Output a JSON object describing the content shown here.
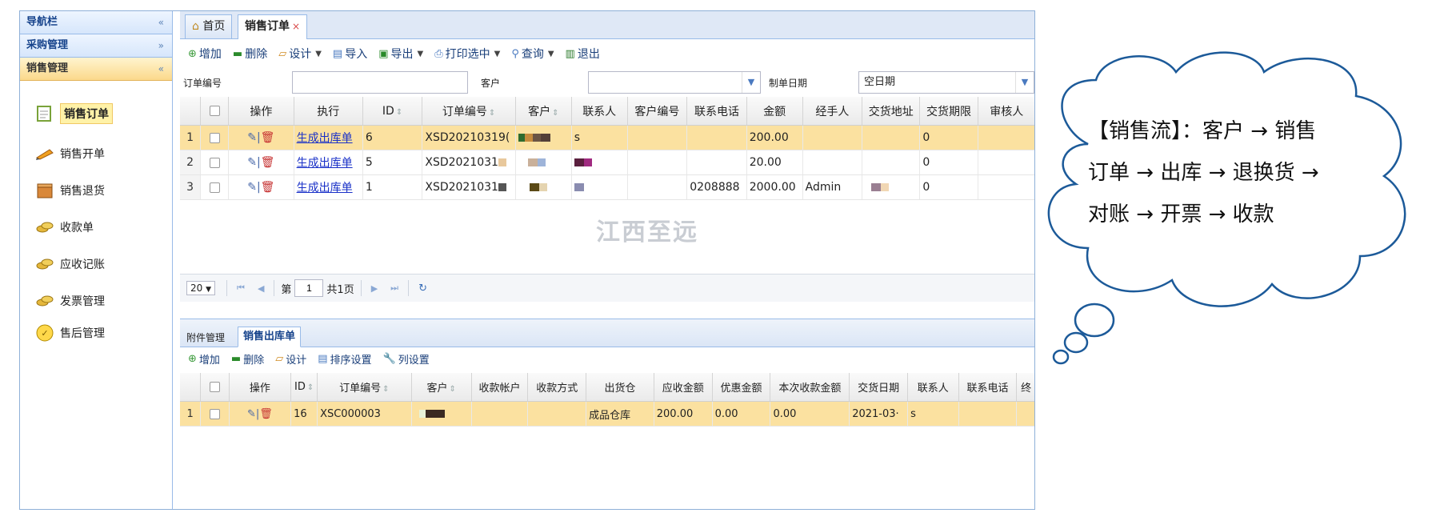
{
  "sidebar": {
    "title": "导航栏",
    "title_chev": "«",
    "groups": [
      {
        "label": "采购管理",
        "chev": "»"
      },
      {
        "label": "销售管理",
        "chev": "«"
      }
    ],
    "items": [
      {
        "label": "销售订单",
        "icon": "document-icon"
      },
      {
        "label": "销售开单",
        "icon": "pencil-icon"
      },
      {
        "label": "销售退货",
        "icon": "box-icon"
      },
      {
        "label": "收款单",
        "icon": "coins-icon"
      },
      {
        "label": "应收记账",
        "icon": "coins-icon"
      },
      {
        "label": "发票管理",
        "icon": "coins-icon"
      },
      {
        "label": "售后管理",
        "icon": "thumbs-up-icon"
      }
    ]
  },
  "tabs": [
    {
      "label": "首页"
    },
    {
      "label": "销售订单",
      "close": "×"
    }
  ],
  "toolbar": {
    "add": "增加",
    "delete": "删除",
    "design": "设计",
    "import": "导入",
    "export": "导出",
    "print": "打印选中",
    "query": "查询",
    "exit": "退出"
  },
  "filters": {
    "order_no_label": "订单编号",
    "order_no_value": "",
    "customer_label": "客户",
    "customer_value": "",
    "date_label": "制单日期",
    "date_value": "空日期"
  },
  "grid": {
    "columns": [
      "操作",
      "执行",
      "ID",
      "订单编号",
      "客户",
      "联系人",
      "客户编号",
      "联系电话",
      "金额",
      "经手人",
      "交货地址",
      "交货期限",
      "审核人"
    ],
    "rows": [
      {
        "num": "1",
        "exec": "生成出库单",
        "id": "6",
        "order": "XSD20210319(",
        "contact": "s",
        "cust_no": "",
        "phone": "",
        "amount": "200.00",
        "handler": "",
        "address": "",
        "deadline": "0",
        "auditor": ""
      },
      {
        "num": "2",
        "exec": "生成出库单",
        "id": "5",
        "order": "XSD2021031",
        "contact": "",
        "cust_no": "",
        "phone": "",
        "amount": "20.00",
        "handler": "",
        "address": "",
        "deadline": "0",
        "auditor": ""
      },
      {
        "num": "3",
        "exec": "生成出库单",
        "id": "1",
        "order": "XSD2021031",
        "contact": "",
        "cust_no": "",
        "phone": "0208888",
        "amount": "2000.00",
        "handler": "Admin",
        "address": "",
        "deadline": "0",
        "auditor": ""
      }
    ]
  },
  "pager": {
    "page_size": "20",
    "page_prefix": "第",
    "page": "1",
    "page_suffix": "共1页"
  },
  "watermark": "江西至远",
  "lower_tabs": [
    {
      "label": "附件管理"
    },
    {
      "label": "销售出库单"
    }
  ],
  "lower_toolbar": {
    "add": "增加",
    "delete": "删除",
    "design": "设计",
    "sort": "排序设置",
    "columns": "列设置"
  },
  "lower_grid": {
    "columns": [
      "操作",
      "ID",
      "订单编号",
      "客户",
      "收款帐户",
      "收款方式",
      "出货仓",
      "应收金额",
      "优惠金额",
      "本次收款金额",
      "交货日期",
      "联系人",
      "联系电话",
      "终"
    ],
    "rows": [
      {
        "num": "1",
        "id": "16",
        "order": "XSC000003",
        "account": "",
        "method": "",
        "warehouse": "成品仓库",
        "receivable": "200.00",
        "discount": "0.00",
        "received": "0.00",
        "date": "2021-03·",
        "contact": "s",
        "phone": ""
      }
    ]
  },
  "cloud": {
    "lines": [
      "【销售流】：客户 → 销售",
      "订单 → 出库 → 退换货 →",
      "对账 → 开票 → 收款"
    ]
  }
}
